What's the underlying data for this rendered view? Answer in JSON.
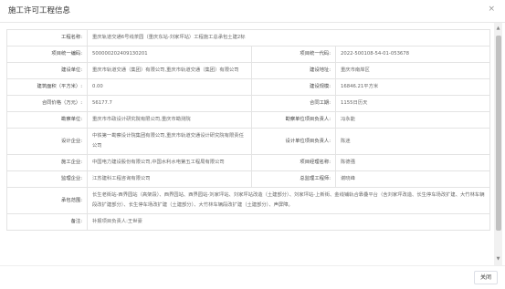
{
  "dialog": {
    "title": "施工许可工程信息",
    "close_label": "关闭",
    "close_icon": "×"
  },
  "fields": {
    "project_name": {
      "label": "工程名称:",
      "value": "重庆轨道交通6号线茶园（重庆东站-刘家坪站）工程施工总承包土建2标"
    },
    "project_code_1": {
      "label": "项目统一编码:",
      "value": "500000202409130201"
    },
    "project_code_2": {
      "label": "项目统一代码:",
      "value": "2022-500108-54-01-053678"
    },
    "builder": {
      "label": "建设单位:",
      "value": "重庆市轨道交通（集团）有限公司,重庆市轨道交通（集团）有限公司"
    },
    "location": {
      "label": "建设地址:",
      "value": "重庆市南岸区"
    },
    "area": {
      "label": "建筑面积（平方米）:",
      "value": "0.00"
    },
    "scale": {
      "label": "建设规模:",
      "value": "16846.21平方米"
    },
    "price": {
      "label": "合同价格（万元）:",
      "value": "56177.7"
    },
    "duration": {
      "label": "合同工期:",
      "value": "1155日历天"
    },
    "survey": {
      "label": "勘察单位:",
      "value": "重庆市市政设计研究院有限公司,重庆市勘测院"
    },
    "survey_lead": {
      "label": "勘察单位项目负责人:",
      "value": "冯永能"
    },
    "design": {
      "label": "设计企业:",
      "value": "中铁第一勘察设计院集团有限公司,重庆市轨道交通设计研究院有限责任公司"
    },
    "design_lead": {
      "label": "设计单位项目负责人:",
      "value": "陈迷"
    },
    "construction": {
      "label": "施工企业:",
      "value": "中国电力建设股份有限公司,中国水利水电第五工程局有限公司"
    },
    "manager": {
      "label": "项目经理名称:",
      "value": "陈德强"
    },
    "supervisor": {
      "label": "监理企业:",
      "value": "江苏建科工程咨询有限公司"
    },
    "chief_engineer": {
      "label": "总监理工程师:",
      "value": "谢晓峰"
    },
    "scope": {
      "label": "承包范围:",
      "value": "长生老街站-西界园站（高架段）、西界园站、西界园站-刘家坪站、刘家坪站改造（土建部分）、刘家坪站-上新街、金线铺轨合靠叠平台（含刘家坪改造、长生停车场改扩建、大竹林车辆段改扩建部分）、长生停车场改扩建（土建部分）、大竹林车辆段改扩建（土建部分）、声屏障。"
    },
    "remark": {
      "label": "备注:",
      "value": "补报项目负责人:王世豪"
    }
  },
  "scrollbar": {
    "up_icon": "▲",
    "down_icon": "▼"
  }
}
